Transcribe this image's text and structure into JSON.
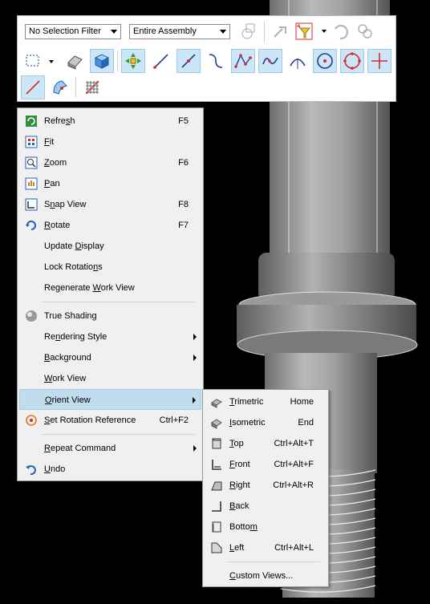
{
  "toolbar": {
    "selection_filter": "No Selection Filter",
    "scope_filter": "Entire Assembly",
    "row2_buttons": [
      {
        "name": "rectangle-select-icon",
        "on": false
      },
      {
        "name": "solid-box-icon",
        "on": false
      },
      {
        "name": "shaded-cube-icon",
        "on": true
      },
      {
        "name": "move-point-icon",
        "on": true
      },
      {
        "name": "line-icon",
        "on": false
      },
      {
        "name": "line-segment-icon",
        "on": true
      },
      {
        "name": "curve-icon",
        "on": false
      },
      {
        "name": "spline-points-icon",
        "on": true
      },
      {
        "name": "spline-icon",
        "on": true
      },
      {
        "name": "arc-icon",
        "on": false
      },
      {
        "name": "circle-center-icon",
        "on": true
      },
      {
        "name": "circle-points-icon",
        "on": true
      },
      {
        "name": "crosshair-icon",
        "on": true
      }
    ]
  },
  "context_menu": {
    "items": [
      {
        "pre": "Refre",
        "u": "s",
        "post": "h",
        "shortcut": "F5",
        "icon": "refresh-icon"
      },
      {
        "pre": "",
        "u": "F",
        "post": "it",
        "shortcut": "",
        "icon": "fit-icon"
      },
      {
        "pre": "",
        "u": "Z",
        "post": "oom",
        "shortcut": "F6",
        "icon": "zoom-icon"
      },
      {
        "pre": "",
        "u": "P",
        "post": "an",
        "shortcut": "",
        "icon": "pan-icon"
      },
      {
        "pre": "S",
        "u": "n",
        "post": "ap View",
        "shortcut": "F8",
        "icon": "snap-view-icon"
      },
      {
        "pre": "",
        "u": "R",
        "post": "otate",
        "shortcut": "F7",
        "icon": "rotate-icon"
      },
      {
        "pre": "Update ",
        "u": "D",
        "post": "isplay",
        "shortcut": "",
        "icon": ""
      },
      {
        "pre": "Lock Rotatio",
        "u": "n",
        "post": "s",
        "shortcut": "",
        "icon": ""
      },
      {
        "pre": "Regenerate ",
        "u": "W",
        "post": "ork View",
        "shortcut": "",
        "icon": ""
      },
      {
        "pre": "True Shadin",
        "u": "g",
        "post": "",
        "shortcut": "",
        "icon": "true-shading-icon"
      },
      {
        "pre": "Re",
        "u": "n",
        "post": "dering Style",
        "shortcut": "",
        "icon": "",
        "submenu": true
      },
      {
        "pre": "",
        "u": "B",
        "post": "ackground",
        "shortcut": "",
        "icon": "",
        "submenu": true
      },
      {
        "pre": "",
        "u": "W",
        "post": "ork View",
        "shortcut": "",
        "icon": ""
      },
      {
        "pre": "",
        "u": "O",
        "post": "rient View",
        "shortcut": "",
        "icon": "",
        "submenu": true,
        "highlight": true
      },
      {
        "pre": "",
        "u": "S",
        "post": "et Rotation Reference",
        "shortcut": "Ctrl+F2",
        "icon": "rotation-reference-icon"
      },
      {
        "pre": "",
        "u": "R",
        "post": "epeat Command",
        "shortcut": "",
        "icon": "",
        "submenu": true
      },
      {
        "pre": "",
        "u": "U",
        "post": "ndo",
        "shortcut": "",
        "icon": "undo-icon"
      }
    ]
  },
  "orient_menu": {
    "items": [
      {
        "pre": "",
        "u": "T",
        "post": "rimetric",
        "shortcut": "Home",
        "icon": "trimetric-icon"
      },
      {
        "pre": "",
        "u": "I",
        "post": "sometric",
        "shortcut": "End",
        "icon": "isometric-icon"
      },
      {
        "pre": "",
        "u": "T",
        "post": "op",
        "shortcut": "Ctrl+Alt+T",
        "icon": "top-view-icon"
      },
      {
        "pre": "",
        "u": "F",
        "post": "ront",
        "shortcut": "Ctrl+Alt+F",
        "icon": "front-view-icon"
      },
      {
        "pre": "",
        "u": "R",
        "post": "ight",
        "shortcut": "Ctrl+Alt+R",
        "icon": "right-view-icon"
      },
      {
        "pre": "",
        "u": "B",
        "post": "ack",
        "shortcut": "",
        "icon": "back-view-icon"
      },
      {
        "pre": "Botto",
        "u": "m",
        "post": "",
        "shortcut": "",
        "icon": "bottom-view-icon"
      },
      {
        "pre": "",
        "u": "L",
        "post": "eft",
        "shortcut": "Ctrl+Alt+L",
        "icon": "left-view-icon"
      },
      {
        "pre": "",
        "u": "C",
        "post": "ustom Views...",
        "shortcut": "",
        "icon": ""
      }
    ]
  },
  "colors": {
    "menu_bg": "#f0f0f0",
    "highlight": "#c0ddee",
    "toolbar_on": "#cde6f7",
    "red": "#d42b2b",
    "blue": "#1f5fbf"
  }
}
